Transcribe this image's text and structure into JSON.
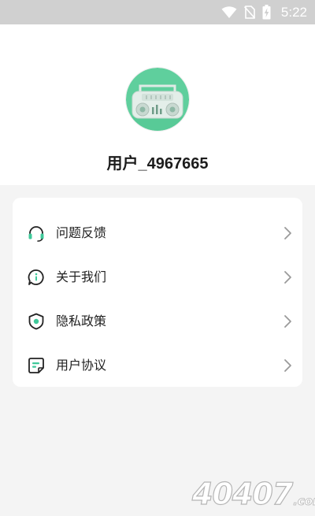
{
  "status_bar": {
    "time": "5:22",
    "icons": [
      "wifi-icon",
      "no-sim-icon",
      "battery-charging-icon"
    ]
  },
  "profile": {
    "avatar_icon": "retro-radio-avatar",
    "username": "用户_4967665"
  },
  "menu": {
    "items": [
      {
        "label": "问题反馈",
        "icon": "headset-icon"
      },
      {
        "label": "关于我们",
        "icon": "info-chat-icon"
      },
      {
        "label": "隐私政策",
        "icon": "shield-icon"
      },
      {
        "label": "用户协议",
        "icon": "document-icon"
      }
    ]
  },
  "colors": {
    "accent": "#3fc99a",
    "avatar_bg": "#5fcf9d",
    "icon_stroke": "#222222",
    "chevron": "#9a9a9a",
    "page_bg": "#f4f4f4"
  },
  "watermark": {
    "text": "40407",
    "suffix": ".com"
  }
}
